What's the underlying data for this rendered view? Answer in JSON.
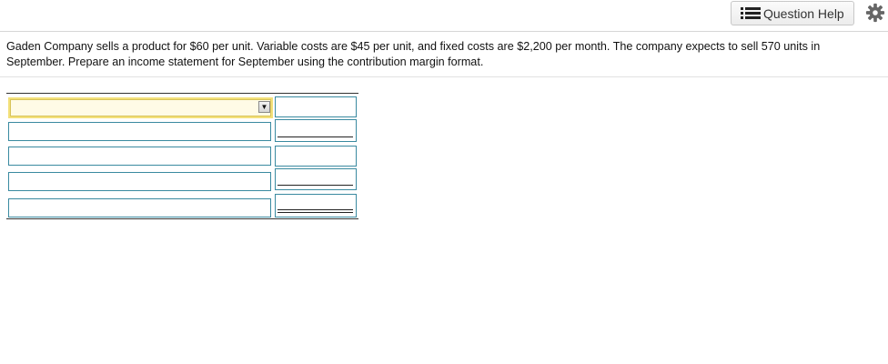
{
  "toolbar": {
    "help_label": "Question Help",
    "help_icon": "list-icon",
    "settings_icon": "gear-icon"
  },
  "question": {
    "text": "Gaden Company sells a product for $60 per unit. Variable costs are $45 per unit, and fixed costs are $2,200 per month. The company expects to sell 570 units in September. Prepare an income statement for September using the contribution margin format."
  },
  "statement": {
    "rows": [
      {
        "label": "",
        "amount": ""
      },
      {
        "label": "",
        "amount": ""
      },
      {
        "label": "",
        "amount": ""
      },
      {
        "label": "",
        "amount": ""
      },
      {
        "label": "",
        "amount": ""
      }
    ],
    "select_arrow": "▼"
  },
  "colors": {
    "field_border": "#3a8aa0",
    "select_highlight": "#f3e07a"
  }
}
